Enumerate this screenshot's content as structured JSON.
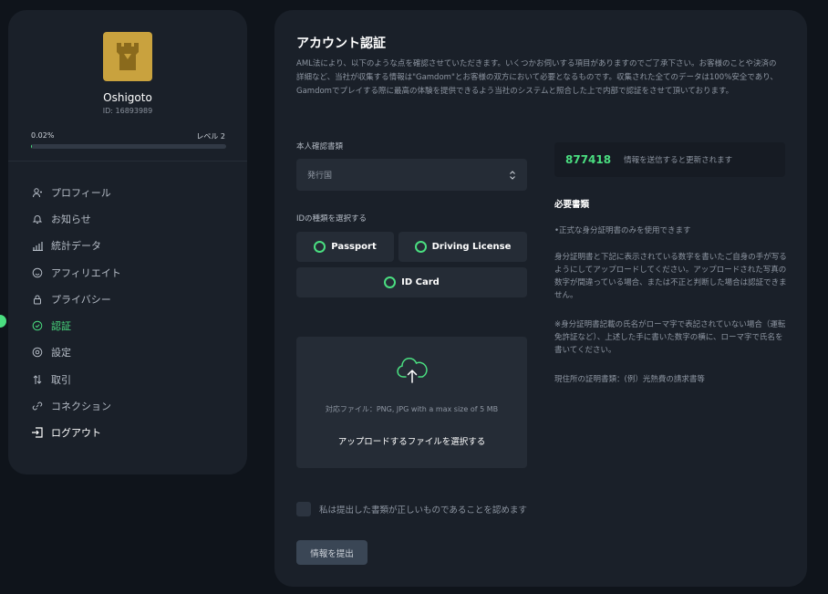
{
  "sidebar": {
    "username": "Oshigoto",
    "user_id": "ID: 16893989",
    "progress_percent": "0.02%",
    "progress_fraction": 0.0002,
    "level": "レベル 2",
    "items": [
      {
        "label": "プロフィール",
        "icon": "user-icon"
      },
      {
        "label": "お知らせ",
        "icon": "bell-icon"
      },
      {
        "label": "統計データ",
        "icon": "bar-chart-icon"
      },
      {
        "label": "アフィリエイト",
        "icon": "smile-icon"
      },
      {
        "label": "プライバシー",
        "icon": "lock-icon"
      },
      {
        "label": "認証",
        "icon": "check-circle-icon",
        "active": true
      },
      {
        "label": "設定",
        "icon": "gear-icon"
      },
      {
        "label": "取引",
        "icon": "arrows-icon"
      },
      {
        "label": "コネクション",
        "icon": "link-icon"
      }
    ],
    "logout_label": "ログアウト"
  },
  "main": {
    "title": "アカウント認証",
    "description": "AML法により、以下のような点を確認させていただきます。いくつかお伺いする項目がありますのでご了承下さい。お客様のことや決済の詳細など、当社が収集する情報は\"Gamdom\"とお客様の双方において必要となるものです。収集された全てのデータは100%安全であり、Gamdomでプレイする際に最高の体験を提供できるよう当社のシステムと照合した上で内部で認証をさせて頂いております。",
    "doc_section_label": "本人確認書類",
    "country_select": "発行国",
    "id_type_label": "IDの種類を選択する",
    "id_types": [
      "Passport",
      "Driving License",
      "ID Card"
    ],
    "upload": {
      "hint": "対応ファイル：PNG, JPG with a max size of 5 MB",
      "cta": "アップロードするファイルを選択する"
    },
    "confirm_text": "私は提出した書類が正しいものであることを認めます",
    "submit_label": "情報を提出",
    "code": "877418",
    "code_hint": "情報を送信すると更新されます",
    "requirements_title": "必要書類",
    "requirements": [
      "•正式な身分証明書のみを使用できます",
      "身分証明書と下記に表示されている数字を書いたご自身の手が写るようにしてアップロードしてください。アップロードされた写真の数字が間違っている場合、または不正と判断した場合は認証できません。",
      "※身分証明書記載の氏名がローマ字で表記されていない場合（運転免許証など）、上述した手に書いた数字の横に、ローマ字で氏名を書いてください。",
      "現住所の証明書類：(例）光熱費の請求書等"
    ]
  },
  "colors": {
    "accent": "#4ade80",
    "panel": "#1a2029",
    "background": "#0f141b",
    "avatar": "#c9a23e"
  }
}
